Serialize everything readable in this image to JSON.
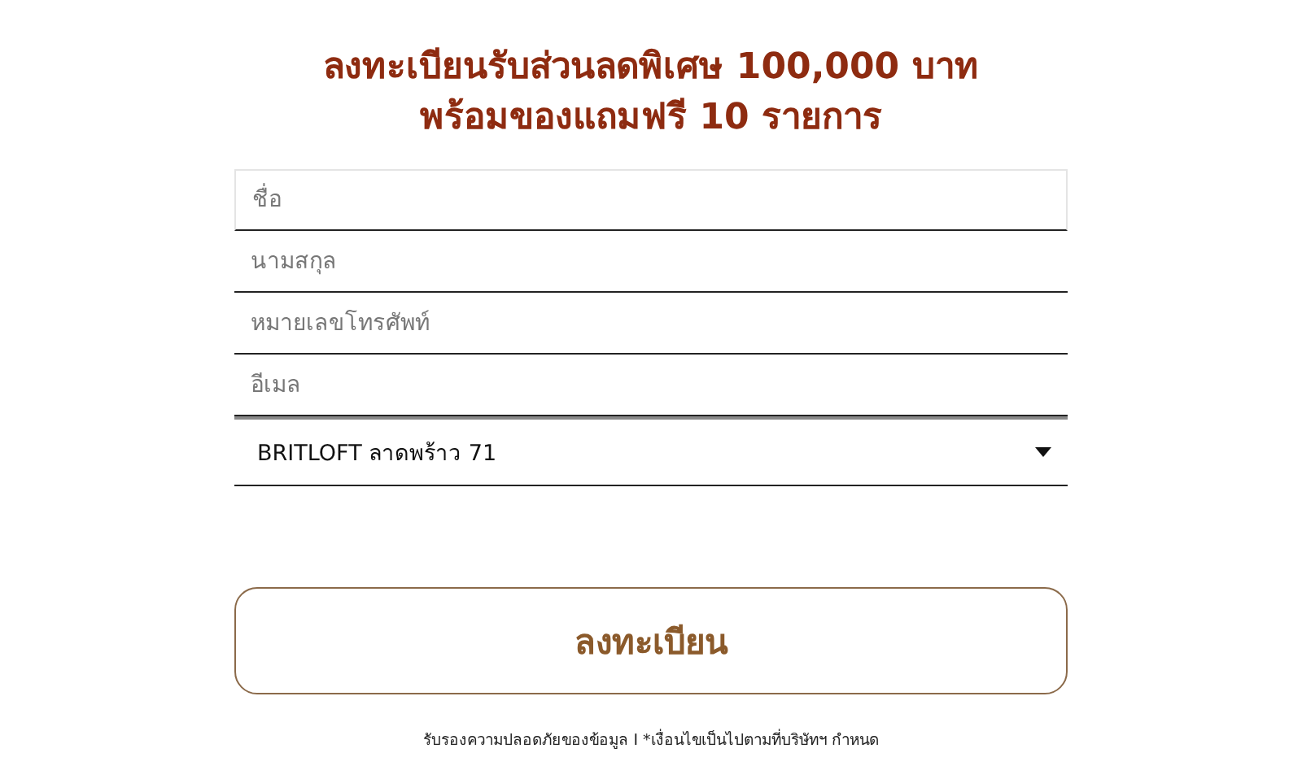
{
  "title_lines": [
    "ลงทะเบียนรับส่วนลดพิเศษ 100,000 บาท",
    "พร้อมของแถมฟรี 10 รายการ"
  ],
  "fields": [
    {
      "placeholder": "ชื่อ",
      "focused": true
    },
    {
      "placeholder": "นามสกุล",
      "focused": false
    },
    {
      "placeholder": "หมายเลขโทรศัพท์",
      "focused": false
    },
    {
      "placeholder": "อีเมล",
      "focused": false
    }
  ],
  "project_select": {
    "value": "BRITLOFT ลาดพร้าว 71"
  },
  "submit_button": "ลงทะเบียน",
  "footnote": "รับรองความปลอดภัยของข้อมูล I *เงื่อนไขเป็นไปตามที่บริษัทฯ กำหนด"
}
